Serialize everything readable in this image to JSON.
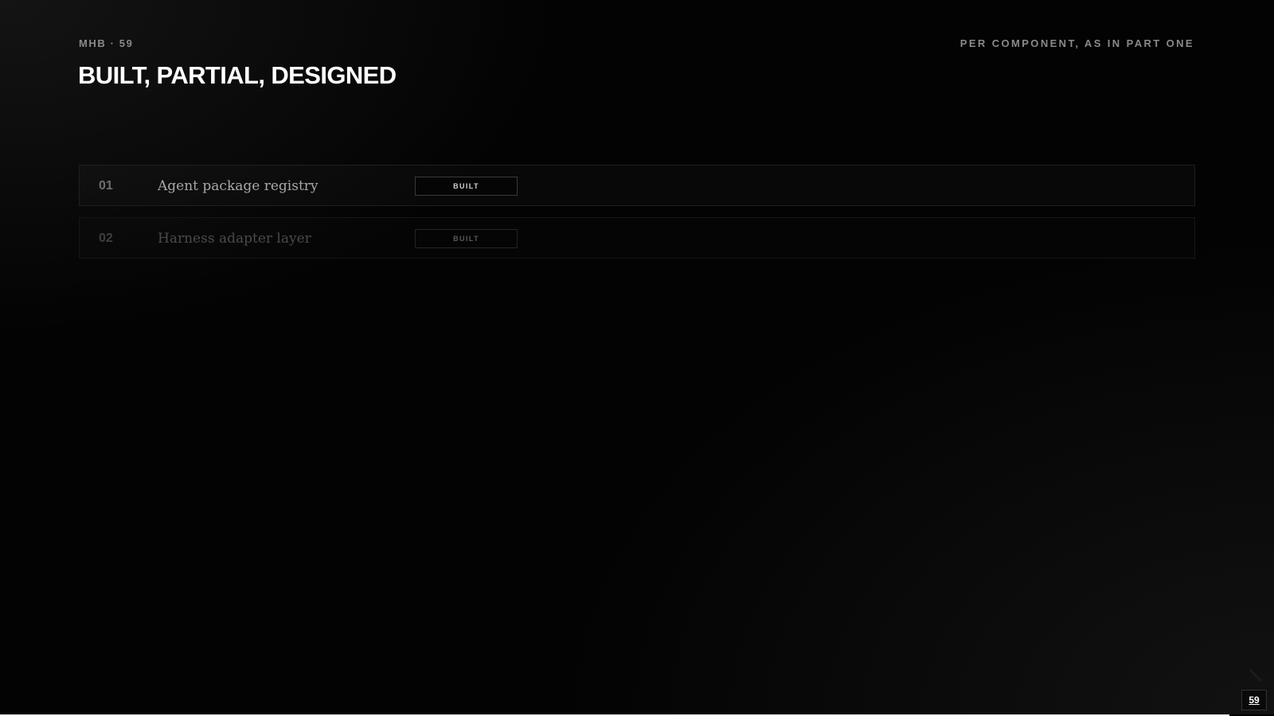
{
  "header": {
    "kicker": "MHB · 59",
    "subtitle": "PER COMPONENT, AS IN PART ONE",
    "title": "BUILT, PARTIAL, DESIGNED"
  },
  "components": [
    {
      "number": "01",
      "name": "Agent package registry",
      "status": "BUILT"
    },
    {
      "number": "02",
      "name": "Harness adapter layer",
      "status": "BUILT"
    }
  ],
  "footer": {
    "page_number": "59",
    "progress_fraction": 0.965
  },
  "icons": {
    "next": "chevron-right-icon"
  },
  "colors": {
    "background": "#030303",
    "title": "#ffffff",
    "muted": "#8a8a8a"
  }
}
